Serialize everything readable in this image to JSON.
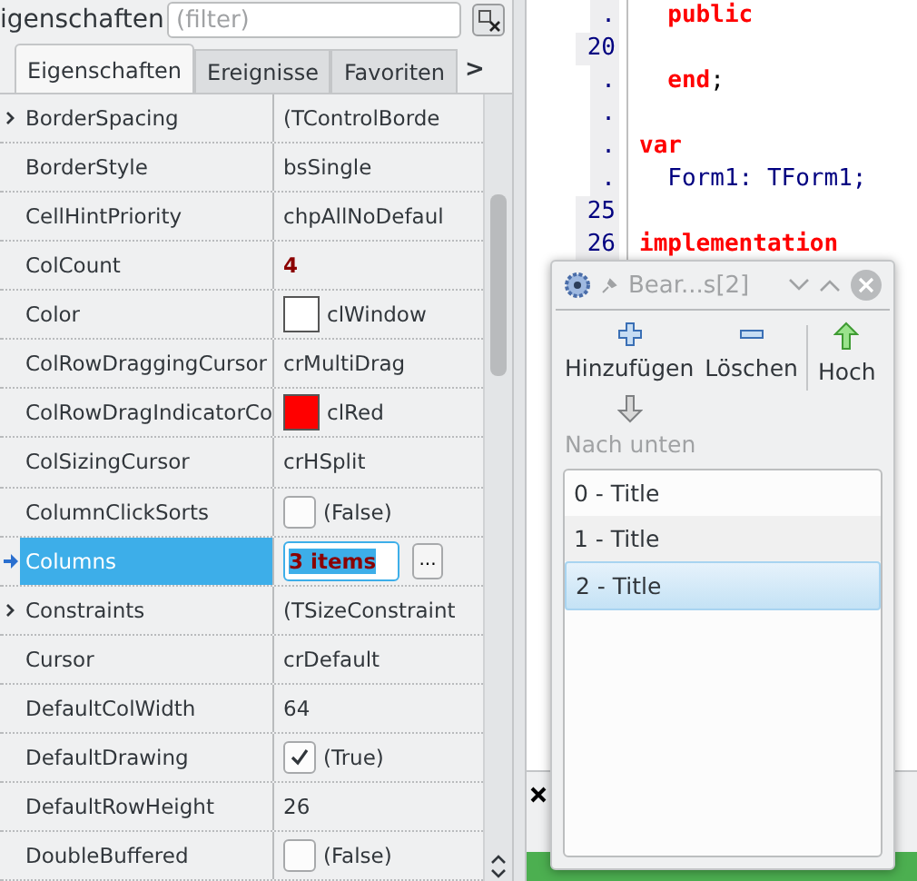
{
  "inspector": {
    "title": "igenschaften",
    "filter": {
      "placeholder": "(filter)"
    },
    "tabs": [
      {
        "label": "Eigenschaften",
        "selected": true
      },
      {
        "label": "Ereignisse",
        "selected": false
      },
      {
        "label": "Favoriten",
        "selected": false
      }
    ],
    "tabs_more": ">",
    "properties": [
      {
        "name": "BorderSpacing",
        "value": "(TControlBorde",
        "kind": "group",
        "modified": false,
        "selected": false
      },
      {
        "name": "BorderStyle",
        "value": "bsSingle",
        "kind": "text",
        "modified": false,
        "selected": false
      },
      {
        "name": "CellHintPriority",
        "value": "chpAllNoDefaul",
        "kind": "text",
        "modified": false,
        "selected": false
      },
      {
        "name": "ColCount",
        "value": "4",
        "kind": "text",
        "modified": true,
        "selected": false
      },
      {
        "name": "Color",
        "value": "clWindow",
        "kind": "color",
        "color": "#ffffff",
        "modified": false,
        "selected": false
      },
      {
        "name": "ColRowDraggingCursor",
        "value": "crMultiDrag",
        "kind": "text",
        "modified": false,
        "selected": false
      },
      {
        "name": "ColRowDragIndicatorCo",
        "value": "clRed",
        "kind": "color",
        "color": "#ff0000",
        "modified": false,
        "selected": false
      },
      {
        "name": "ColSizingCursor",
        "value": "crHSplit",
        "kind": "text",
        "modified": false,
        "selected": false
      },
      {
        "name": "ColumnClickSorts",
        "value": "(False)",
        "kind": "checkbox",
        "checked": false,
        "modified": false,
        "selected": false
      },
      {
        "name": "Columns",
        "value": "3 items",
        "kind": "edit",
        "button": "...",
        "modified": true,
        "selected": true
      },
      {
        "name": "Constraints",
        "value": "(TSizeConstraint",
        "kind": "group",
        "modified": false,
        "selected": false
      },
      {
        "name": "Cursor",
        "value": "crDefault",
        "kind": "text",
        "modified": false,
        "selected": false
      },
      {
        "name": "DefaultColWidth",
        "value": "64",
        "kind": "text",
        "modified": false,
        "selected": false
      },
      {
        "name": "DefaultDrawing",
        "value": "(True)",
        "kind": "checkbox",
        "checked": true,
        "modified": false,
        "selected": false
      },
      {
        "name": "DefaultRowHeight",
        "value": "26",
        "kind": "text",
        "modified": false,
        "selected": false
      },
      {
        "name": "DoubleBuffered",
        "value": "(False)",
        "kind": "checkbox",
        "checked": false,
        "modified": false,
        "selected": false
      }
    ]
  },
  "editor": {
    "lines": [
      {
        "number": ".",
        "segments": [
          {
            "text": "  public",
            "kind": "keyword"
          }
        ]
      },
      {
        "number": "20"
      },
      {
        "number": ".",
        "segments": [
          {
            "text": "  end",
            "kind": "keyword"
          },
          {
            "text": ";",
            "kind": "symbol"
          }
        ]
      },
      {
        "number": "."
      },
      {
        "number": ".",
        "segments": [
          {
            "text": "var",
            "kind": "keyword"
          }
        ]
      },
      {
        "number": ".",
        "segments": [
          {
            "text": "  Form1: TForm1;",
            "kind": "ident"
          }
        ]
      },
      {
        "number": "25"
      },
      {
        "number": "26",
        "segments": [
          {
            "text": "implementation",
            "kind": "keyword"
          }
        ]
      }
    ]
  },
  "dialog": {
    "title": "Bear...s[2]",
    "tools": [
      {
        "label": "Hinzufügen",
        "disabled": false
      },
      {
        "label": "Löschen",
        "disabled": false
      },
      {
        "label": "Hoch",
        "disabled": false
      },
      {
        "label": "Nach unten",
        "disabled": true
      }
    ],
    "items": [
      {
        "label": "0 - Title",
        "selected": false
      },
      {
        "label": "1 - Title",
        "selected": false
      },
      {
        "label": "2 - Title",
        "selected": true
      }
    ]
  }
}
